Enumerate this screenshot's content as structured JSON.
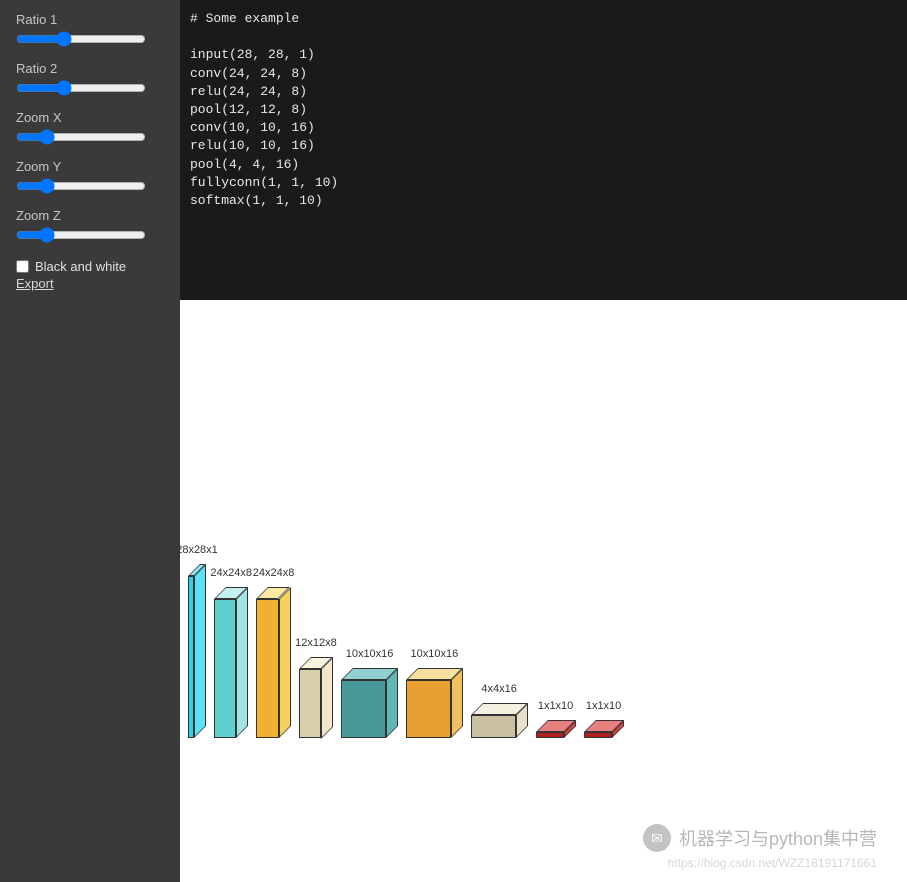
{
  "sidebar": {
    "sliders": [
      {
        "label": "Ratio 1",
        "value": 35
      },
      {
        "label": "Ratio 2",
        "value": 35
      },
      {
        "label": "Zoom X",
        "value": 20
      },
      {
        "label": "Zoom Y",
        "value": 20
      },
      {
        "label": "Zoom Z",
        "value": 20
      }
    ],
    "checkbox_label": "Black and white",
    "checkbox_checked": false,
    "export_label": "Export"
  },
  "code": "# Some example\n\ninput(28, 28, 1)\nconv(24, 24, 8)\nrelu(24, 24, 8)\npool(12, 12, 8)\nconv(10, 10, 16)\nrelu(10, 10, 16)\npool(4, 4, 16)\nfullyconn(1, 1, 10)\nsoftmax(1, 1, 10)",
  "chart_data": {
    "type": "diagram",
    "description": "Neural network layer visualization as 3D cuboids",
    "layers": [
      {
        "label": "28x28x1",
        "w": 28,
        "h": 28,
        "d": 1,
        "color_front": "#30d0e8",
        "color_side": "#5ce0f5",
        "color_top": "#8eecf9"
      },
      {
        "label": "24x24x8",
        "w": 24,
        "h": 24,
        "d": 8,
        "color_front": "#5fcfcf",
        "color_side": "#a0e5e5",
        "color_top": "#c5f0f0"
      },
      {
        "label": "24x24x8",
        "w": 24,
        "h": 24,
        "d": 8,
        "color_front": "#f0b030",
        "color_side": "#f8d060",
        "color_top": "#fce8a0"
      },
      {
        "label": "12x12x8",
        "w": 12,
        "h": 12,
        "d": 8,
        "color_front": "#d8d0a8",
        "color_side": "#f0e8c8",
        "color_top": "#f8f4e0"
      },
      {
        "label": "10x10x16",
        "w": 10,
        "h": 10,
        "d": 16,
        "color_front": "#4a9999",
        "color_side": "#60b5b5",
        "color_top": "#90d0d0"
      },
      {
        "label": "10x10x16",
        "w": 10,
        "h": 10,
        "d": 16,
        "color_front": "#e8a030",
        "color_side": "#f0c060",
        "color_top": "#f8e0a0"
      },
      {
        "label": "4x4x16",
        "w": 4,
        "h": 4,
        "d": 16,
        "color_front": "#c8c0a0",
        "color_side": "#e8e0c8",
        "color_top": "#f4f0e0"
      },
      {
        "label": "1x1x10",
        "w": 1,
        "h": 1,
        "d": 10,
        "color_front": "#b02020",
        "color_side": "#d04040",
        "color_top": "#e88080"
      },
      {
        "label": "1x1x10",
        "w": 1,
        "h": 1,
        "d": 10,
        "color_front": "#b02020",
        "color_side": "#d04040",
        "color_top": "#e88080"
      }
    ]
  },
  "watermark": {
    "text": "机器学习与python集中营",
    "sub": "https://blog.csdn.net/WZZ18191171661"
  }
}
